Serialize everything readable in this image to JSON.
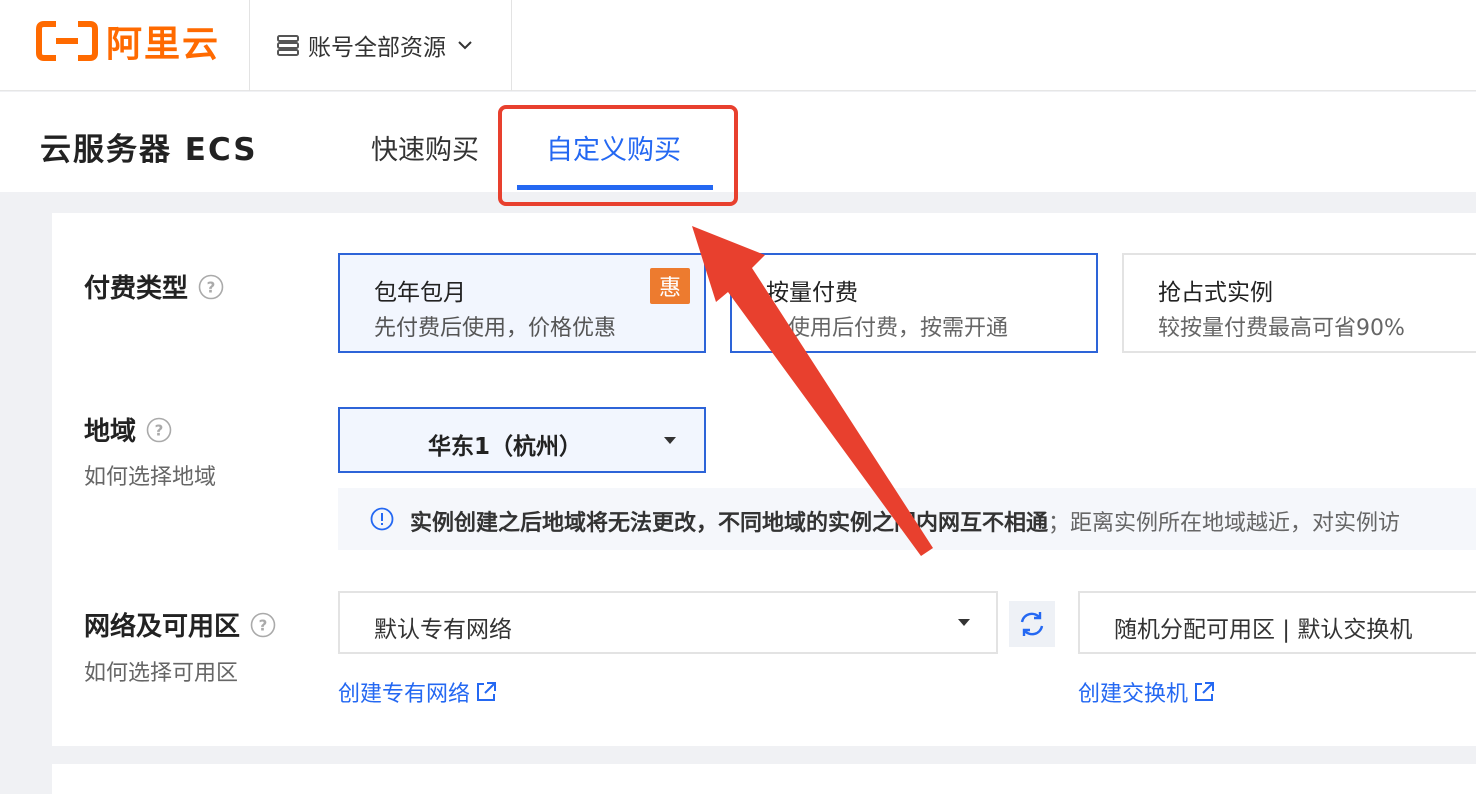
{
  "brand": {
    "name": "阿里云",
    "color": "#ff6a00"
  },
  "topbar": {
    "account_label": "账号全部资源"
  },
  "header": {
    "title": "云服务器 ECS",
    "tabs": [
      {
        "label": "快速购买",
        "active": false
      },
      {
        "label": "自定义购买",
        "active": true
      }
    ]
  },
  "billing": {
    "label": "付费类型",
    "options": [
      {
        "title": "包年包月",
        "desc": "先付费后使用，价格优惠",
        "badge": "惠",
        "selected": true
      },
      {
        "title": "按量付费",
        "desc": "先使用后付费，按需开通",
        "selected": false
      },
      {
        "title": "抢占式实例",
        "desc": "较按量付费最高可省90%",
        "selected": false
      }
    ]
  },
  "region": {
    "label": "地域",
    "help_link": "如何选择地域",
    "value": "华东1（杭州）",
    "notice_bold": "实例创建之后地域将无法更改，不同地域的实例之间内网互不相通",
    "notice_rest": "；距离实例所在地域越近，对实例访"
  },
  "network": {
    "label": "网络及可用区",
    "help_link": "如何选择可用区",
    "vpc_value": "默认专有网络",
    "zone_value": "随机分配可用区 | 默认交换机",
    "create_vpc_link": "创建专有网络",
    "create_switch_link": "创建交换机"
  },
  "colors": {
    "accent": "#2468f2",
    "annotation_red": "#e8402e",
    "badge": "#ed7b2f"
  }
}
